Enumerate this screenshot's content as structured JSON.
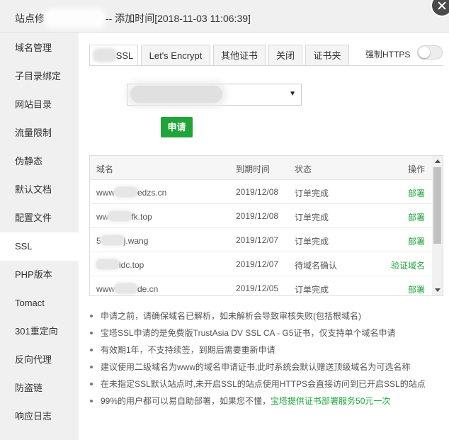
{
  "title": {
    "prefix": "站点修",
    "suffix": "-- 添加时间[2018-11-03 11:06:39]"
  },
  "sidebar": {
    "items": [
      {
        "label": "域名管理"
      },
      {
        "label": "子目录绑定"
      },
      {
        "label": "网站目录"
      },
      {
        "label": "流量限制"
      },
      {
        "label": "伪静态"
      },
      {
        "label": "默认文档"
      },
      {
        "label": "配置文件"
      },
      {
        "label": "SSL",
        "active": true
      },
      {
        "label": "PHP版本"
      },
      {
        "label": "Tomact"
      },
      {
        "label": "301重定向"
      },
      {
        "label": "反向代理"
      },
      {
        "label": "防盗链"
      },
      {
        "label": "响应日志"
      }
    ]
  },
  "tabs": {
    "items": [
      {
        "label": "SSL",
        "active": true
      },
      {
        "label": "Let's Encrypt"
      },
      {
        "label": "其他证书"
      },
      {
        "label": "关闭"
      },
      {
        "label": "证书夹"
      }
    ],
    "force_https_label": "强制HTTPS",
    "force_https_on": false
  },
  "form": {
    "site_select_caret": "▼",
    "apply_button": "申请"
  },
  "table": {
    "headers": {
      "domain": "域名",
      "expire": "到期时间",
      "status": "状态",
      "action": "操作"
    },
    "rows": [
      {
        "domain_pre": "www",
        "domain_post": "edzs.cn",
        "expire": "2019/12/08",
        "status": "订单完成",
        "action": "部署"
      },
      {
        "domain_pre": "ww",
        "domain_post": "fk.top",
        "expire": "2019/12/08",
        "status": "订单完成",
        "action": "部署"
      },
      {
        "domain_pre": "5",
        "domain_post": "j.wang",
        "expire": "2019/12/07",
        "status": "订单完成",
        "action": "部署"
      },
      {
        "domain_pre": "",
        "domain_post": "idc.top",
        "expire": "2019/12/07",
        "status": "待域名确认",
        "action": "验证域名"
      },
      {
        "domain_pre": "www",
        "domain_post": "de.cn",
        "expire": "2019/12/05",
        "status": "订单完成",
        "action": "部署"
      }
    ]
  },
  "notes": {
    "items": [
      "申请之前，请确保域名已解析，如未解析会导致审核失败(包括根域名)",
      "宝塔SSL申请的是免费版TrustAsia DV SSL CA - G5证书，仅支持单个域名申请",
      "有效期1年，不支持续签，到期后需要重新申请",
      "建议使用二级域名为www的域名申请证书,此时系统会默认赠送顶级域名为可选名称",
      "在未指定SSL默认站点时,未开启SSL的站点使用HTTPS会直接访问到已开启SSL的站点"
    ],
    "last_text": "99%的用户都可以易自助部署，如果您不懂，",
    "last_link": "宝塔提供证书部署服务50元一次"
  },
  "colors": {
    "accent_green": "#20a53a",
    "sidebar_bg": "#f0f0f0",
    "titlebar_bg": "#f0f0f0"
  }
}
